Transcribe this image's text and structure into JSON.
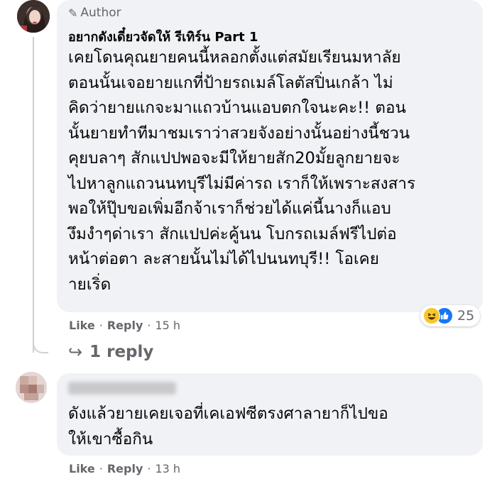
{
  "comment1": {
    "badge": "Author",
    "author_name": "อยากดังเดี๋ยวจัดให้ รีเทิร์น Part 1",
    "lines": [
      "เคยโดนคุณยายคนนี้หลอกตั้งแต่สมัยเรียนมหาลัย",
      "ตอนนั้นเจอยายแกที่ป้ายรถเมล์โลตัสปิ่นเกล้า ไม่",
      "คิดว่ายายแกจะมาแถวบ้านแอบตกใจนะคะ!! ตอน",
      "นั้นยายทำทีมาชมเราว่าสวยจังอย่างนั้นอย่างนี้ชวน",
      "คุยบลาๆ สักแปปพอจะมีให้ยายสัก20มั้ยลูกยายจะ",
      "ไปหาลูกแถวนนทบุรีไม่มีค่ารถ เราก็ให้เพราะสงสาร",
      "พอให้ปุ๊บขอเพิ่มอีกจ้าเราก็ช่วยได้แค่นี้นางก็แอบ",
      "งึมงำๆด่าเรา สักแปปค่ะคู้นน โบกรถเมล์ฟรีไปต่อ",
      "หน้าต่อตา ละสายนั้นไม่ได้ไปนนทบุรี!! โอเคย",
      "ายเริ่ด"
    ],
    "reaction_count": "25",
    "like_label": "Like",
    "reply_label": "Reply",
    "separator": "·",
    "time": "15 h"
  },
  "replies_link": "1 reply",
  "comment2": {
    "lines": [
      "ดังแล้วยายเคยเจอที่เคเอฟซีตรงศาลายาก็ไปขอ",
      "ให้เขาซื้อกิน"
    ],
    "like_label": "Like",
    "reply_label": "Reply",
    "separator": "·",
    "time": "13 h"
  },
  "icons": {
    "author": "pencil-icon",
    "reactions": [
      "haha-reaction-icon",
      "like-reaction-icon"
    ],
    "replies": "reply-arrow-icon"
  },
  "colors": {
    "bubble": "#f0f2f5",
    "secondary_text": "#65676b",
    "like_blue": "#1877f2",
    "haha_yellow": "#f7c62b"
  }
}
